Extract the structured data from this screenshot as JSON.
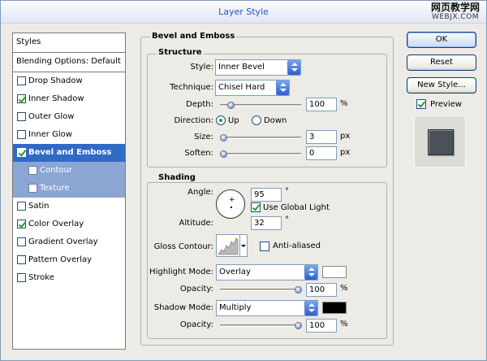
{
  "window": {
    "title": "Layer Style",
    "watermark_line1": "网页教学网",
    "watermark_line2": "WEBJX.COM"
  },
  "styles_panel": {
    "header": "Styles",
    "blending_options": "Blending Options: Default",
    "items": [
      {
        "label": "Drop Shadow",
        "checked": false
      },
      {
        "label": "Inner Shadow",
        "checked": true
      },
      {
        "label": "Outer Glow",
        "checked": false
      },
      {
        "label": "Inner Glow",
        "checked": false
      },
      {
        "label": "Bevel and Emboss",
        "checked": true,
        "selected": true
      },
      {
        "label": "Contour",
        "checked": false,
        "sub": true
      },
      {
        "label": "Texture",
        "checked": false,
        "sub": true
      },
      {
        "label": "Satin",
        "checked": false
      },
      {
        "label": "Color Overlay",
        "checked": true
      },
      {
        "label": "Gradient Overlay",
        "checked": false
      },
      {
        "label": "Pattern Overlay",
        "checked": false
      },
      {
        "label": "Stroke",
        "checked": false
      }
    ]
  },
  "bevel": {
    "group_title": "Bevel and Emboss",
    "structure": {
      "title": "Structure",
      "style_label": "Style:",
      "style_value": "Inner Bevel",
      "technique_label": "Technique:",
      "technique_value": "Chisel Hard",
      "depth_label": "Depth:",
      "depth_value": "100",
      "depth_unit": "%",
      "depth_fraction": 0.1,
      "direction_label": "Direction:",
      "direction_up": "Up",
      "direction_down": "Down",
      "size_label": "Size:",
      "size_value": "3",
      "size_unit": "px",
      "size_fraction": 0.0,
      "soften_label": "Soften:",
      "soften_value": "0",
      "soften_unit": "px",
      "soften_fraction": 0.0
    },
    "shading": {
      "title": "Shading",
      "angle_label": "Angle:",
      "angle_value": "95",
      "angle_unit": "°",
      "use_global_light": "Use Global Light",
      "altitude_label": "Altitude:",
      "altitude_value": "32",
      "altitude_unit": "°",
      "gloss_contour_label": "Gloss Contour:",
      "anti_aliased": "Anti-aliased",
      "highlight_mode_label": "Highlight Mode:",
      "highlight_mode_value": "Overlay",
      "highlight_color": "#ffffff",
      "highlight_opacity_label": "Opacity:",
      "highlight_opacity_value": "100",
      "highlight_opacity_unit": "%",
      "highlight_opacity_fraction": 1.0,
      "shadow_mode_label": "Shadow Mode:",
      "shadow_mode_value": "Multiply",
      "shadow_color": "#000000",
      "shadow_opacity_label": "Opacity:",
      "shadow_opacity_value": "100",
      "shadow_opacity_unit": "%",
      "shadow_opacity_fraction": 1.0
    }
  },
  "buttons": {
    "ok": "OK",
    "reset": "Reset",
    "new_style": "New Style...",
    "preview": "Preview"
  }
}
